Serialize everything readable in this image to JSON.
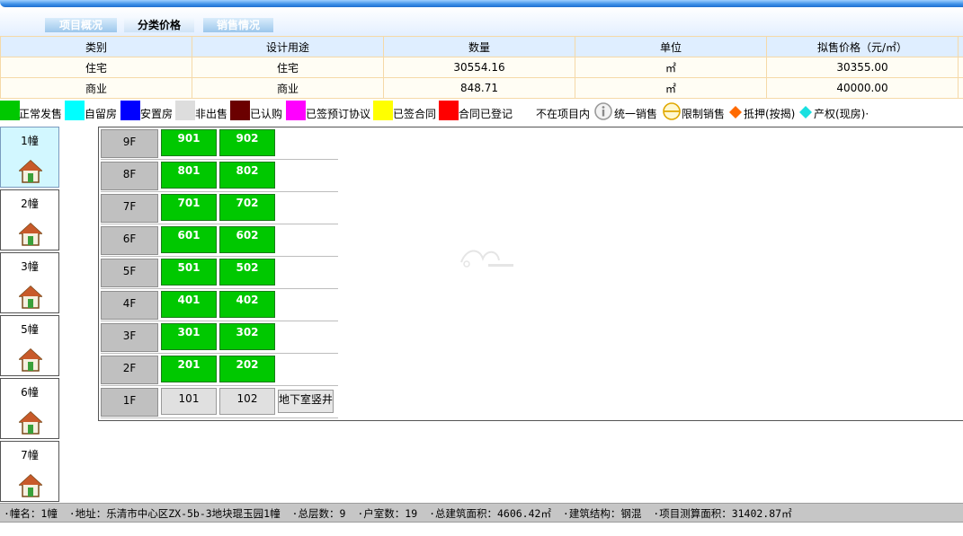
{
  "tabs": [
    {
      "label": "项目概况",
      "active": false
    },
    {
      "label": "分类价格",
      "active": true
    },
    {
      "label": "销售情况",
      "active": false
    }
  ],
  "price_table": {
    "headers": [
      "类别",
      "设计用途",
      "数量",
      "单位",
      "拟售价格（元/㎡）"
    ],
    "rows": [
      [
        "住宅",
        "住宅",
        "30554.16",
        "㎡",
        "30355.00"
      ],
      [
        "商业",
        "商业",
        "848.71",
        "㎡",
        "40000.00"
      ]
    ]
  },
  "legend": [
    {
      "label": "正常发售",
      "color": "#00c800"
    },
    {
      "label": "自留房",
      "color": "#00ffff"
    },
    {
      "label": "安置房",
      "color": "#0000ff"
    },
    {
      "label": "非出售",
      "color": "#dddddd"
    },
    {
      "label": "已认购",
      "color": "#6b0000"
    },
    {
      "label": "已签预订协议",
      "color": "#ff00ff"
    },
    {
      "label": "已签合同",
      "color": "#ffff00"
    },
    {
      "label": "合同已登记",
      "color": "#ff0000"
    },
    {
      "label": "不在项目内",
      "color": "#ffffff"
    },
    {
      "label": "统一销售",
      "icon": "info-circle-icon"
    },
    {
      "label": "限制销售",
      "icon": "restricted-circle-icon"
    },
    {
      "label": "抵押(按揭)",
      "icon": "orange-diamond-icon"
    },
    {
      "label": "产权(现房)·",
      "icon": "cyan-diamond-icon"
    }
  ],
  "buildings": [
    {
      "label": "1幢",
      "selected": true
    },
    {
      "label": "2幢",
      "selected": false
    },
    {
      "label": "3幢",
      "selected": false
    },
    {
      "label": "5幢",
      "selected": false
    },
    {
      "label": "6幢",
      "selected": false
    },
    {
      "label": "7幢",
      "selected": false
    }
  ],
  "floors": [
    {
      "label": "9F",
      "units": [
        {
          "no": "901",
          "status": "正常发售"
        },
        {
          "no": "902",
          "status": "正常发售"
        }
      ]
    },
    {
      "label": "8F",
      "units": [
        {
          "no": "801",
          "status": "正常发售"
        },
        {
          "no": "802",
          "status": "正常发售"
        }
      ]
    },
    {
      "label": "7F",
      "units": [
        {
          "no": "701",
          "status": "正常发售"
        },
        {
          "no": "702",
          "status": "正常发售"
        }
      ]
    },
    {
      "label": "6F",
      "units": [
        {
          "no": "601",
          "status": "正常发售"
        },
        {
          "no": "602",
          "status": "正常发售"
        }
      ]
    },
    {
      "label": "5F",
      "units": [
        {
          "no": "501",
          "status": "正常发售"
        },
        {
          "no": "502",
          "status": "正常发售"
        }
      ]
    },
    {
      "label": "4F",
      "units": [
        {
          "no": "401",
          "status": "正常发售"
        },
        {
          "no": "402",
          "status": "正常发售"
        }
      ]
    },
    {
      "label": "3F",
      "units": [
        {
          "no": "301",
          "status": "正常发售"
        },
        {
          "no": "302",
          "status": "正常发售"
        }
      ]
    },
    {
      "label": "2F",
      "units": [
        {
          "no": "201",
          "status": "正常发售"
        },
        {
          "no": "202",
          "status": "正常发售"
        }
      ]
    },
    {
      "label": "1F",
      "units": [
        {
          "no": "101",
          "status": "非出售"
        },
        {
          "no": "102",
          "status": "非出售"
        }
      ],
      "extra": "地下室竖井"
    }
  ],
  "status_bar": [
    "·幢名：1幢",
    "·地址：乐清市中心区ZX-5b-3地块琨玉园1幢",
    "·总层数：9",
    "·户室数：19",
    "·总建筑面积：4606.42㎡",
    "·建筑结构：钢混",
    "·项目测算面积：31402.87㎡"
  ],
  "colors": {
    "accent_blue": "#1f6fd0",
    "green_unit": "#00c800",
    "grey_unit": "#e0e0e0",
    "selected_building": "#d2f7ff"
  }
}
